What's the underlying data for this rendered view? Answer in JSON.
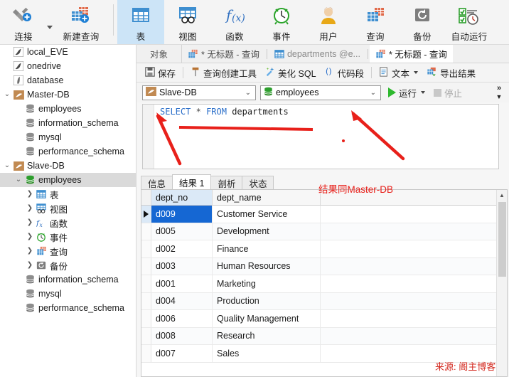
{
  "ribbon": {
    "items": [
      {
        "label": "连接",
        "icon": "connect-plus-icon",
        "selected": false,
        "has_caret": true
      },
      {
        "label": "新建查询",
        "icon": "new-query-icon",
        "selected": false,
        "has_caret": false
      },
      {
        "label": "表",
        "icon": "table-icon",
        "selected": true,
        "has_caret": false
      },
      {
        "label": "视图",
        "icon": "view-icon",
        "selected": false,
        "has_caret": false
      },
      {
        "label": "函数",
        "icon": "function-fx-icon",
        "selected": false,
        "has_caret": false
      },
      {
        "label": "事件",
        "icon": "event-clock-icon",
        "selected": false,
        "has_caret": false
      },
      {
        "label": "用户",
        "icon": "user-icon",
        "selected": false,
        "has_caret": false
      },
      {
        "label": "查询",
        "icon": "query-icon",
        "selected": false,
        "has_caret": false
      },
      {
        "label": "备份",
        "icon": "backup-icon",
        "selected": false,
        "has_caret": false
      },
      {
        "label": "自动运行",
        "icon": "automation-icon",
        "selected": false,
        "has_caret": false
      }
    ]
  },
  "tree": {
    "nodes": [
      {
        "label": "local_EVE",
        "icon": "connection-icon",
        "indent": 0,
        "twist": "",
        "selected": false
      },
      {
        "label": "onedrive",
        "icon": "connection-icon",
        "indent": 0,
        "twist": "",
        "selected": false
      },
      {
        "label": "database",
        "icon": "connection-gray-icon",
        "indent": 0,
        "twist": "",
        "selected": false
      },
      {
        "label": "Master-DB",
        "icon": "mariadb-icon",
        "indent": 0,
        "twist": "v",
        "selected": false
      },
      {
        "label": "employees",
        "icon": "database-icon",
        "indent": 1,
        "twist": "",
        "selected": false
      },
      {
        "label": "information_schema",
        "icon": "database-icon",
        "indent": 1,
        "twist": "",
        "selected": false
      },
      {
        "label": "mysql",
        "icon": "database-icon",
        "indent": 1,
        "twist": "",
        "selected": false
      },
      {
        "label": "performance_schema",
        "icon": "database-icon",
        "indent": 1,
        "twist": "",
        "selected": false
      },
      {
        "label": "Slave-DB",
        "icon": "mariadb-icon",
        "indent": 0,
        "twist": "v",
        "selected": false
      },
      {
        "label": "employees",
        "icon": "database-open-icon",
        "indent": 1,
        "twist": "v",
        "selected": true
      },
      {
        "label": "表",
        "icon": "table-icon",
        "indent": 2,
        "twist": ">",
        "selected": false
      },
      {
        "label": "视图",
        "icon": "view-icon",
        "indent": 2,
        "twist": ">",
        "selected": false
      },
      {
        "label": "函数",
        "icon": "function-fx-icon",
        "indent": 2,
        "twist": ">",
        "selected": false
      },
      {
        "label": "事件",
        "icon": "event-clock-icon",
        "indent": 2,
        "twist": ">",
        "selected": false
      },
      {
        "label": "查询",
        "icon": "query-icon",
        "indent": 2,
        "twist": ">",
        "selected": false
      },
      {
        "label": "备份",
        "icon": "backup-icon",
        "indent": 2,
        "twist": ">",
        "selected": false
      },
      {
        "label": "information_schema",
        "icon": "database-icon",
        "indent": 1,
        "twist": "",
        "selected": false
      },
      {
        "label": "mysql",
        "icon": "database-icon",
        "indent": 1,
        "twist": "",
        "selected": false
      },
      {
        "label": "performance_schema",
        "icon": "database-icon",
        "indent": 1,
        "twist": "",
        "selected": false
      }
    ]
  },
  "doc_tabs": {
    "objects_label": "对象",
    "tabs": [
      {
        "label": "* 无标题 - 查询",
        "icon": "query-icon",
        "active": false,
        "dim": false
      },
      {
        "label": "departments @e...",
        "icon": "table-icon",
        "active": false,
        "dim": true
      },
      {
        "label": "* 无标题 - 查询",
        "icon": "query-icon",
        "active": true,
        "dim": false
      }
    ]
  },
  "action_toolbar": {
    "items": [
      {
        "label": "保存",
        "icon": "save-icon"
      },
      {
        "label": "查询创建工具",
        "icon": "query-builder-icon"
      },
      {
        "label": "美化 SQL",
        "icon": "beautify-sql-icon"
      },
      {
        "label": "代码段",
        "icon": "code-snippet-icon"
      },
      {
        "label": "文本",
        "icon": "text-icon",
        "caret": true
      },
      {
        "label": "导出结果",
        "icon": "export-result-icon"
      }
    ]
  },
  "query_bar": {
    "connection": {
      "value": "Slave-DB",
      "icon": "mariadb-icon"
    },
    "database": {
      "value": "employees",
      "icon": "database-open-icon"
    },
    "run_label": "运行",
    "stop_label": "停止",
    "overflow_glyph": "»"
  },
  "editor": {
    "sql_tokens": [
      {
        "text": "SELECT",
        "type": "kw"
      },
      {
        "text": " ",
        "type": "op"
      },
      {
        "text": "*",
        "type": "op"
      },
      {
        "text": " ",
        "type": "op"
      },
      {
        "text": "FROM",
        "type": "kw"
      },
      {
        "text": " ",
        "type": "op"
      },
      {
        "text": "departments",
        "type": "id"
      }
    ],
    "sql_plain": "SELECT * FROM departments"
  },
  "result_tabs": [
    {
      "label": "信息",
      "active": false
    },
    {
      "label": "结果 1",
      "active": true
    },
    {
      "label": "剖析",
      "active": false
    },
    {
      "label": "状态",
      "active": false
    }
  ],
  "grid": {
    "columns": [
      "dept_no",
      "dept_name"
    ],
    "rows": [
      {
        "dept_no": "d009",
        "dept_name": "Customer Service"
      },
      {
        "dept_no": "d005",
        "dept_name": "Development"
      },
      {
        "dept_no": "d002",
        "dept_name": "Finance"
      },
      {
        "dept_no": "d003",
        "dept_name": "Human Resources"
      },
      {
        "dept_no": "d001",
        "dept_name": "Marketing"
      },
      {
        "dept_no": "d004",
        "dept_name": "Production"
      },
      {
        "dept_no": "d006",
        "dept_name": "Quality Management"
      },
      {
        "dept_no": "d008",
        "dept_name": "Research"
      },
      {
        "dept_no": "d007",
        "dept_name": "Sales"
      }
    ],
    "current_row_index": 0
  },
  "annotations": {
    "result_note": "结果同Master-DB",
    "watermark": "来源: 阁主博客",
    "color": "#e8201a"
  }
}
